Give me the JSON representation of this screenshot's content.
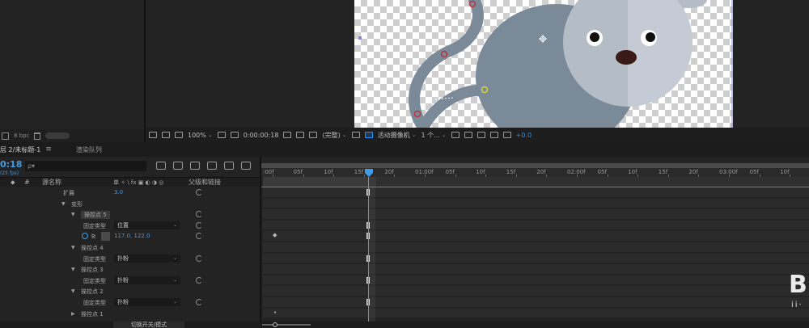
{
  "project": {
    "bpc": "8 bpc"
  },
  "viewer_toolbar": {
    "zoom": "100%",
    "timecode": "0:00:00:18",
    "resolution": "(完整)",
    "camera": "活动摄像机",
    "views": "1 个...",
    "exposure": "+0.0"
  },
  "timeline": {
    "tab_comp": "层 2/未标题-1",
    "tab_render": "渲染队列",
    "current_time": "0:18",
    "fps": "(25 fps)",
    "search_placeholder": "ρ▾",
    "columns": {
      "hash": "#",
      "source_name": "源名称",
      "switches": "单 ✧ \\ fx ▣ ◐ ◑ ◎",
      "parent": "父级和链接"
    },
    "rows": [
      {
        "twirl": "",
        "label": "扩展",
        "value": "3.0",
        "type": "value"
      },
      {
        "twirl": "▼",
        "label": "变形",
        "type": "group"
      },
      {
        "twirl": "▼",
        "label": "操控点 5",
        "type": "group",
        "highlight": true
      },
      {
        "twirl": "",
        "label": "固定类型",
        "dropdown": "位置",
        "type": "dropdown"
      },
      {
        "twirl": "",
        "label": "",
        "value": "117.0, 122.0",
        "type": "position"
      },
      {
        "twirl": "▼",
        "label": "操控点 4",
        "type": "group"
      },
      {
        "twirl": "",
        "label": "固定类型",
        "dropdown": "扑粉",
        "type": "dropdown"
      },
      {
        "twirl": "▼",
        "label": "操控点 3",
        "type": "group"
      },
      {
        "twirl": "",
        "label": "固定类型",
        "dropdown": "扑粉",
        "type": "dropdown"
      },
      {
        "twirl": "▼",
        "label": "操控点 2",
        "type": "group"
      },
      {
        "twirl": "",
        "label": "固定类型",
        "dropdown": "扑粉",
        "type": "dropdown"
      },
      {
        "twirl": "▶",
        "label": "操控点 1",
        "type": "group"
      }
    ],
    "ruler_labels": [
      ":00f",
      "05f",
      "10f",
      "15f",
      "20f",
      "01:00f",
      "05f",
      "10f",
      "15f",
      "20f",
      "02:00f",
      "05f",
      "10f",
      "15f",
      "20f",
      "03:00f",
      "05f",
      "10f"
    ],
    "toggle_modes": "切换开关/模式"
  },
  "watermark": {
    "logo": "B",
    "sub": "ii·"
  },
  "colors": {
    "accent_blue": "#3f9be6",
    "mouse_body": "#7a8a99",
    "mouse_face": "#b4bcc6",
    "work_area_green": "#3aa83a"
  }
}
